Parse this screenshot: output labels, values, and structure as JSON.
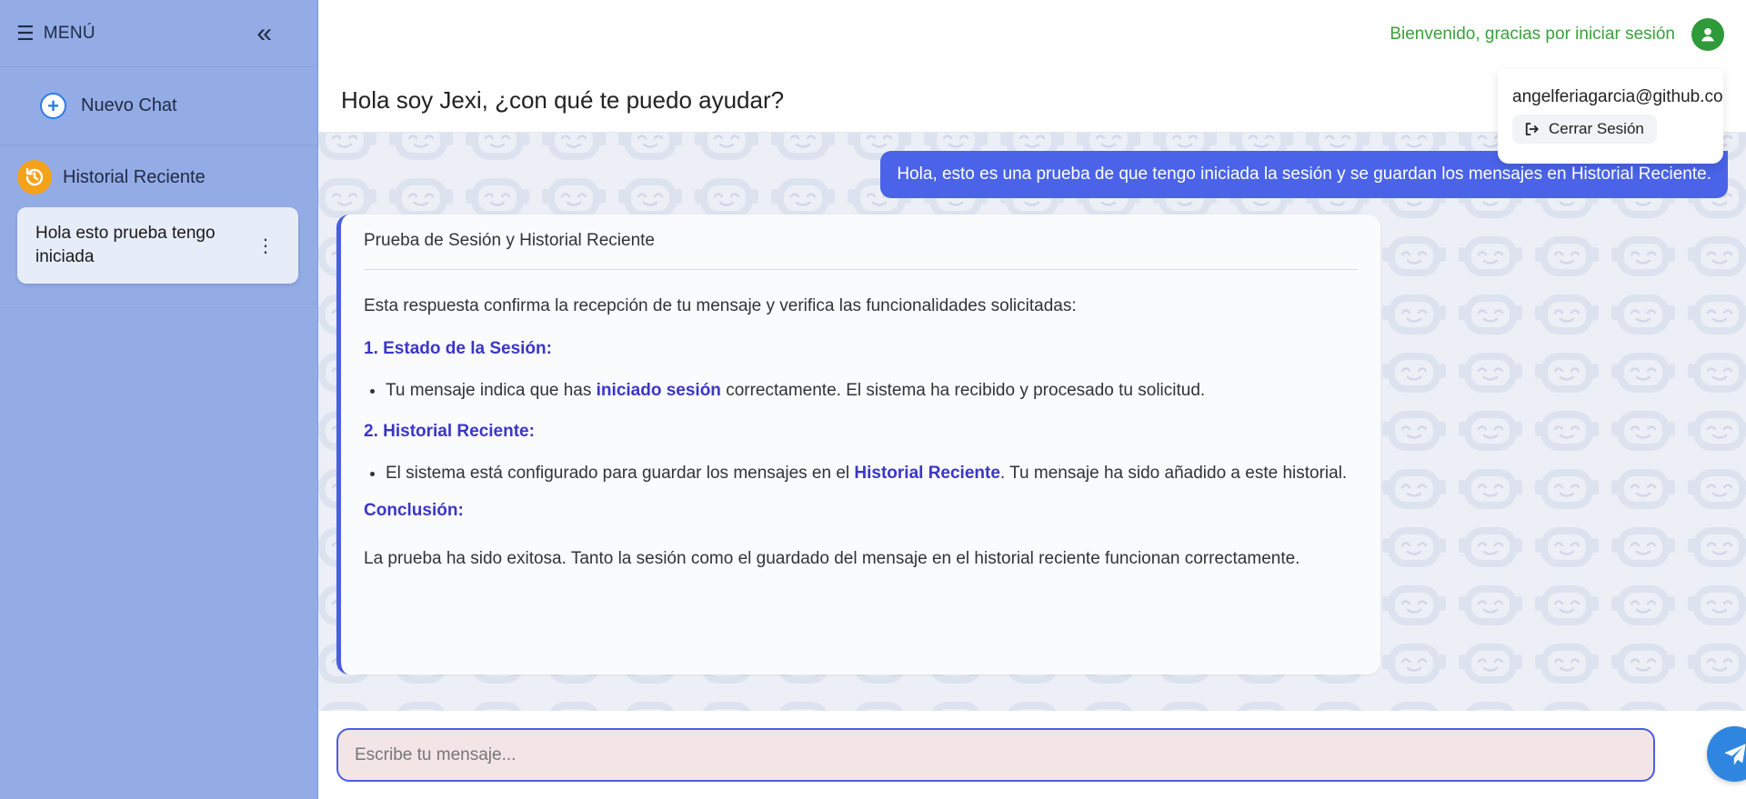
{
  "sidebar": {
    "menu_label": "MENÚ",
    "new_chat_label": "Nuevo Chat",
    "history_title": "Historial Reciente",
    "history_items": [
      {
        "label": "Hola esto prueba tengo iniciada"
      }
    ]
  },
  "topbar": {
    "welcome_text": "Bienvenido, gracias por iniciar sesión"
  },
  "user_menu": {
    "email": "angelferiagarcia@github.com",
    "logout_label": "Cerrar Sesión"
  },
  "chat": {
    "title": "Hola soy Jexi, ¿con qué te puedo ayudar?",
    "user_message": "Hola, esto es una prueba de que tengo iniciada la sesión y se guardan los mensajes en Historial Reciente.",
    "bot_response": {
      "title": "Prueba de Sesión y Historial Reciente",
      "intro": "Esta respuesta confirma la recepción de tu mensaje y verifica las funcionalidades solicitadas:",
      "section1_heading": "1. Estado de la Sesión:",
      "section1_item_pre": "Tu mensaje indica que has ",
      "section1_item_bold": "iniciado sesión",
      "section1_item_post": " correctamente. El sistema ha recibido y procesado tu solicitud.",
      "section2_heading": "2. Historial Reciente:",
      "section2_item_pre": "El sistema está configurado para guardar los mensajes en el ",
      "section2_item_bold": "Historial Reciente",
      "section2_item_post": ". Tu mensaje ha sido añadido a este historial.",
      "conclusion_heading": "Conclusión:",
      "conclusion_text": "La prueba ha sido exitosa. Tanto la sesión como el guardado del mensaje en el historial reciente funcionan correctamente."
    }
  },
  "input": {
    "placeholder": "Escribe tu mensaje..."
  },
  "icons": {
    "menu": "hamburger-icon",
    "collapse": "double-chevron-left-icon",
    "new_chat": "plus-circle-icon",
    "history": "history-icon",
    "history_options": "kebab-icon",
    "user": "user-circle-icon",
    "logout": "logout-icon",
    "send": "paper-plane-icon",
    "background": "robot-face-icon"
  },
  "colors": {
    "sidebar_bg": "#93ace6",
    "accent_blue": "#4a5ee0",
    "user_bubble": "#4a63e8",
    "highlight_text": "#3b36c6",
    "welcome_green": "#3aa23a",
    "history_orange": "#f5a21b",
    "send_button": "#2f86e0"
  }
}
